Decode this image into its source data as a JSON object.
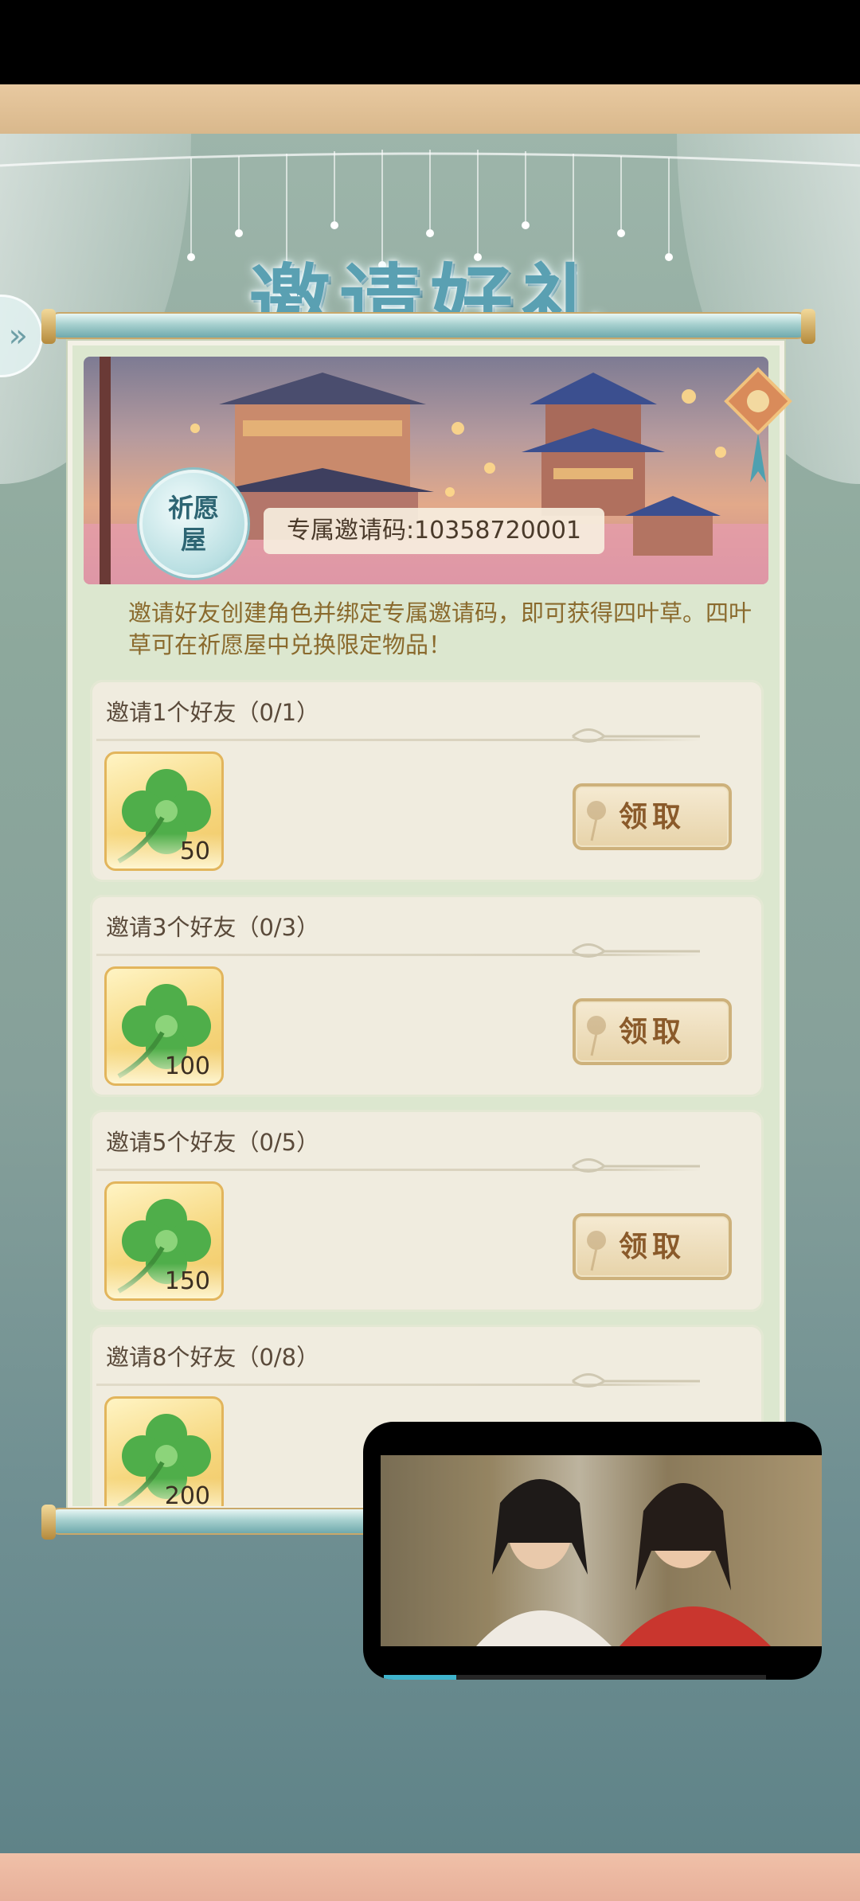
{
  "page": {
    "title": "邀请好礼",
    "side_arrow_glyph": "»",
    "wish_house": "祈愿屋",
    "invite_code": "专属邀请码:10358720001",
    "description": "邀请好友创建角色并绑定专属邀请码，即可获得四叶草。四叶草可在祈愿屋中兑换限定物品！"
  },
  "tasks": [
    {
      "title": "邀请1个好友（0/1）",
      "reward_icon": "four-leaf-clover-icon",
      "reward_qty": "50",
      "button_label": "领取"
    },
    {
      "title": "邀请3个好友（0/3）",
      "reward_icon": "four-leaf-clover-icon",
      "reward_qty": "100",
      "button_label": "领取"
    },
    {
      "title": "邀请5个好友（0/5）",
      "reward_icon": "four-leaf-clover-icon",
      "reward_qty": "150",
      "button_label": "领取"
    },
    {
      "title": "邀请8个好友（0/8）",
      "reward_icon": "four-leaf-clover-icon",
      "reward_qty": "200",
      "button_label": ""
    }
  ],
  "video": {
    "progress": 0.19
  },
  "colors": {
    "title": "#5aa0b2",
    "description": "#8a6a2d",
    "button_text": "#8a5a2a",
    "clover": "#4fae4a",
    "progress": "#3fb3cc"
  }
}
